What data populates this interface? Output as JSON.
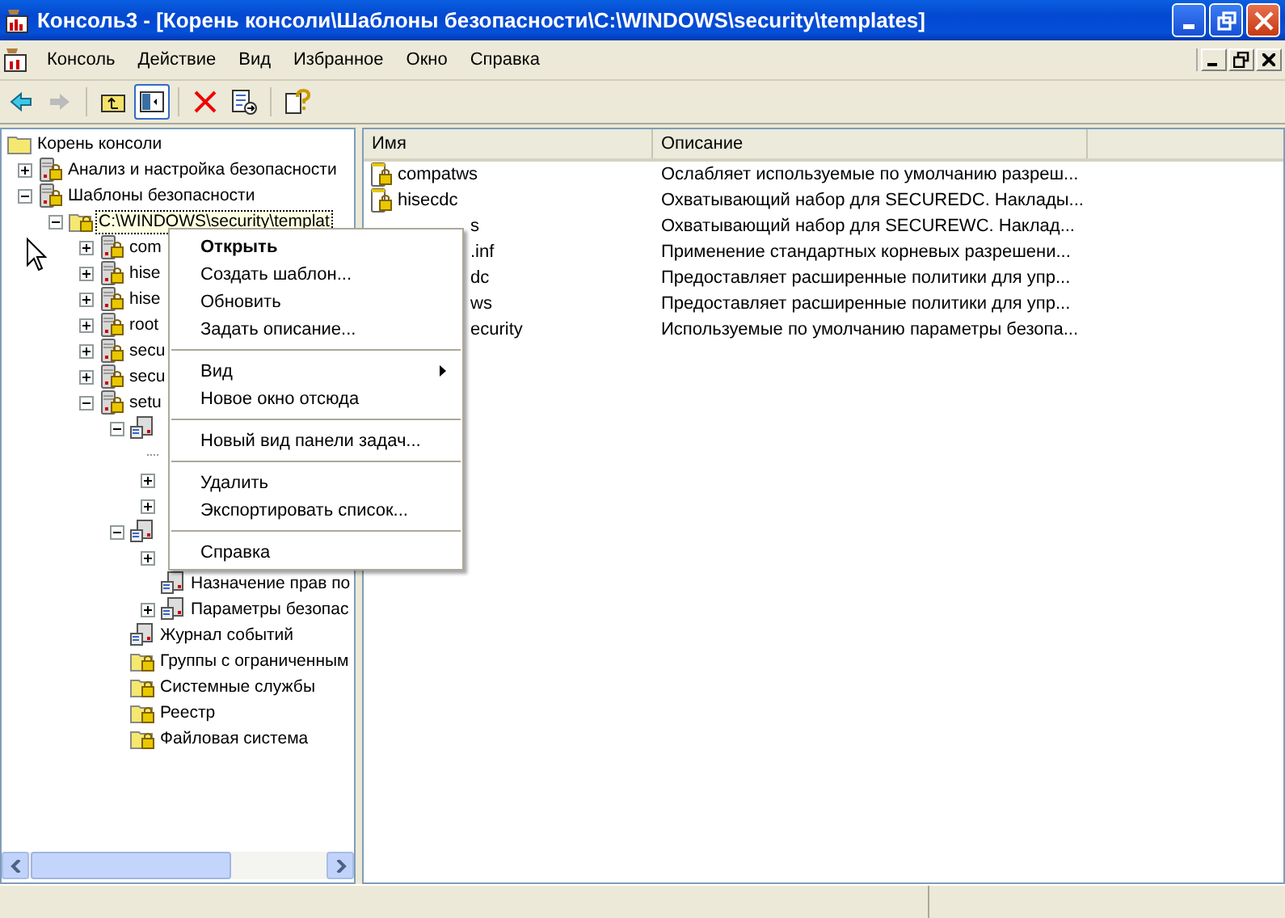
{
  "window": {
    "title": "Консоль3 - [Корень консоли\\Шаблоны безопасности\\C:\\WINDOWS\\security\\templates]"
  },
  "menu": [
    "Консоль",
    "Действие",
    "Вид",
    "Избранное",
    "Окно",
    "Справка"
  ],
  "tree": [
    {
      "label": "Корень консоли",
      "kind": "folder",
      "selected": false,
      "children": [
        {
          "label": "Анализ и настройка безопасности",
          "kind": "server",
          "expanded": false,
          "selected": false
        },
        {
          "label": "Шаблоны безопасности",
          "kind": "server",
          "expanded": true,
          "selected": false,
          "children": [
            {
              "label": "C:\\WINDOWS\\security\\templat",
              "kind": "lockfolder",
              "expanded": true,
              "selected": true,
              "children": [
                {
                  "label": "com",
                  "kind": "server",
                  "expanded": false,
                  "selected": false
                },
                {
                  "label": "hise",
                  "kind": "server",
                  "expanded": false,
                  "selected": false
                },
                {
                  "label": "hise",
                  "kind": "server",
                  "expanded": false,
                  "selected": false
                },
                {
                  "label": "root",
                  "kind": "server",
                  "expanded": false,
                  "selected": false
                },
                {
                  "label": "secu",
                  "kind": "server",
                  "expanded": false,
                  "selected": false
                },
                {
                  "label": "secu",
                  "kind": "server",
                  "expanded": false,
                  "selected": false
                },
                {
                  "label": "setu",
                  "kind": "server",
                  "expanded": true,
                  "selected": false,
                  "children": [
                    {
                      "kind": "computer",
                      "expanded": true,
                      "children": [
                        {
                          "connector": true
                        },
                        {
                          "expanded": false
                        },
                        {
                          "expanded": false
                        }
                      ]
                    },
                    {
                      "kind": "computer",
                      "expanded": true,
                      "children": [
                        {
                          "expanded": false
                        },
                        {
                          "label": "Назначение прав по",
                          "kind": "computer",
                          "selected": false
                        },
                        {
                          "label": "Параметры безопас",
                          "kind": "computer",
                          "expanded": false,
                          "selected": false
                        }
                      ]
                    },
                    {
                      "label": "Журнал событий",
                      "kind": "computer",
                      "selected": false
                    },
                    {
                      "label": "Группы с ограниченным",
                      "kind": "lockfolder",
                      "selected": false
                    },
                    {
                      "label": "Системные службы",
                      "kind": "lockfolder",
                      "selected": false
                    },
                    {
                      "label": "Реестр",
                      "kind": "lockfolder",
                      "selected": false
                    },
                    {
                      "label": "Файловая система",
                      "kind": "lockfolder",
                      "selected": false
                    }
                  ]
                }
              ]
            }
          ]
        }
      ]
    }
  ],
  "list": {
    "columns": [
      "Имя",
      "Описание"
    ],
    "rows": [
      {
        "name": "compatws",
        "occluded": false,
        "description": "Ослабляет используемые по умолчанию разреш..."
      },
      {
        "name": "hisecdc",
        "occluded": false,
        "description": "Охватывающий набор для SECUREDC. Наклады..."
      },
      {
        "name": "s",
        "occluded": true,
        "description": "Охватывающий набор для SECUREWC. Наклад..."
      },
      {
        "name": ".inf",
        "occluded": true,
        "description": "Применение стандартных корневых разрешени..."
      },
      {
        "name": "dc",
        "occluded": true,
        "description": "Предоставляет расширенные политики для упр..."
      },
      {
        "name": "ws",
        "occluded": true,
        "description": "Предоставляет расширенные политики для упр..."
      },
      {
        "name": "ecurity",
        "occluded": true,
        "description": "Используемые по умолчанию параметры безопа..."
      }
    ]
  },
  "context_menu": [
    {
      "kind": "default",
      "label": "Открыть"
    },
    {
      "kind": "item",
      "label": "Создать шаблон..."
    },
    {
      "kind": "item",
      "label": "Обновить"
    },
    {
      "kind": "item",
      "label": "Задать описание..."
    },
    {
      "kind": "separator"
    },
    {
      "kind": "submenu",
      "label": "Вид"
    },
    {
      "kind": "item",
      "label": "Новое окно отсюда"
    },
    {
      "kind": "separator"
    },
    {
      "kind": "item",
      "label": "Новый вид панели задач..."
    },
    {
      "kind": "separator"
    },
    {
      "kind": "item",
      "label": "Удалить"
    },
    {
      "kind": "item",
      "label": "Экспортировать список..."
    },
    {
      "kind": "separator"
    },
    {
      "kind": "item",
      "label": "Справка"
    }
  ]
}
